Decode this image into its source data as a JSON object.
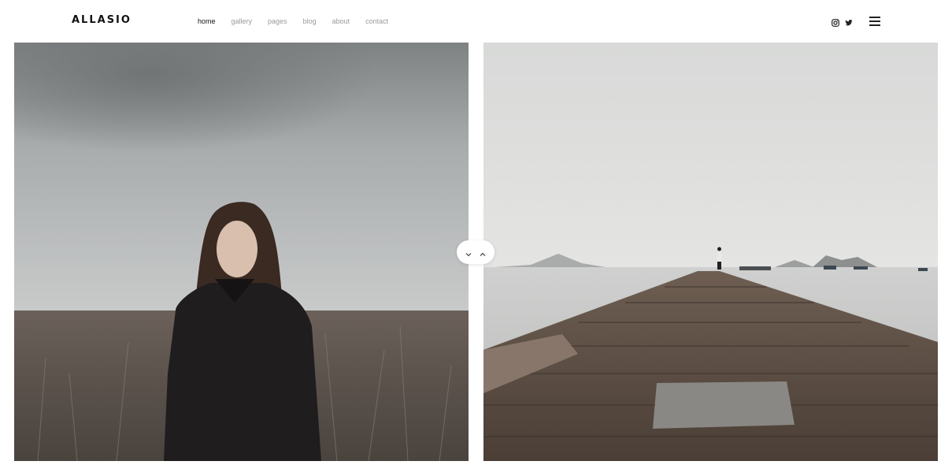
{
  "brand": {
    "logo": "ALLASIO"
  },
  "nav": {
    "items": [
      {
        "label": "home",
        "active": true
      },
      {
        "label": "gallery",
        "active": false
      },
      {
        "label": "pages",
        "active": false
      },
      {
        "label": "blog",
        "active": false
      },
      {
        "label": "about",
        "active": false
      },
      {
        "label": "contact",
        "active": false
      }
    ]
  },
  "social": {
    "icons": [
      "instagram-icon",
      "twitter-icon"
    ]
  },
  "menu": {
    "icon": "hamburger-icon"
  },
  "slides": [
    {
      "subject": "woman-in-field"
    },
    {
      "subject": "wooden-pier"
    }
  ],
  "slider": {
    "prev_icon": "chevron-down-icon",
    "next_icon": "chevron-up-icon"
  }
}
